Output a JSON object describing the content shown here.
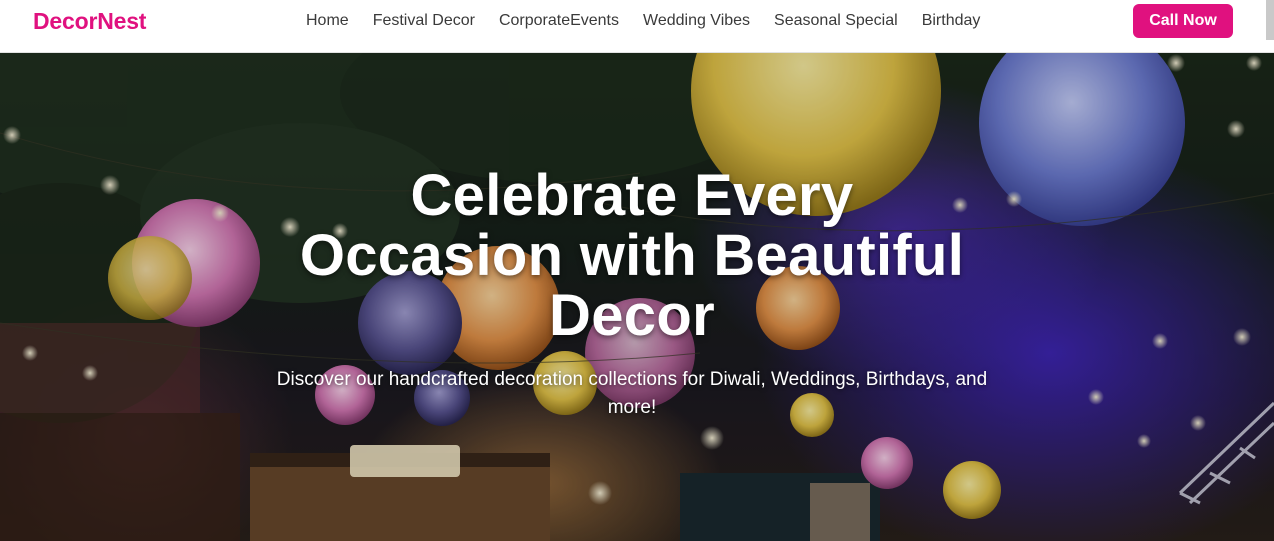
{
  "brand": {
    "name": "DecorNest"
  },
  "nav": {
    "items": [
      {
        "label": "Home"
      },
      {
        "label": "Festival Decor"
      },
      {
        "label": "CorporateEvents"
      },
      {
        "label": "Wedding Vibes"
      },
      {
        "label": "Seasonal Special"
      },
      {
        "label": "Birthday"
      }
    ],
    "cta_label": "Call Now"
  },
  "hero": {
    "title_line1": "Celebrate Every",
    "title_line2": "Occasion with Beautiful",
    "title_line3": "Decor",
    "subtitle": "Discover our handcrafted decoration collections for Diwali, Weddings, Birthdays, and more!"
  },
  "colors": {
    "brand": "#e0117f",
    "nav_text": "#3a3a3a",
    "hero_text": "#ffffff"
  }
}
